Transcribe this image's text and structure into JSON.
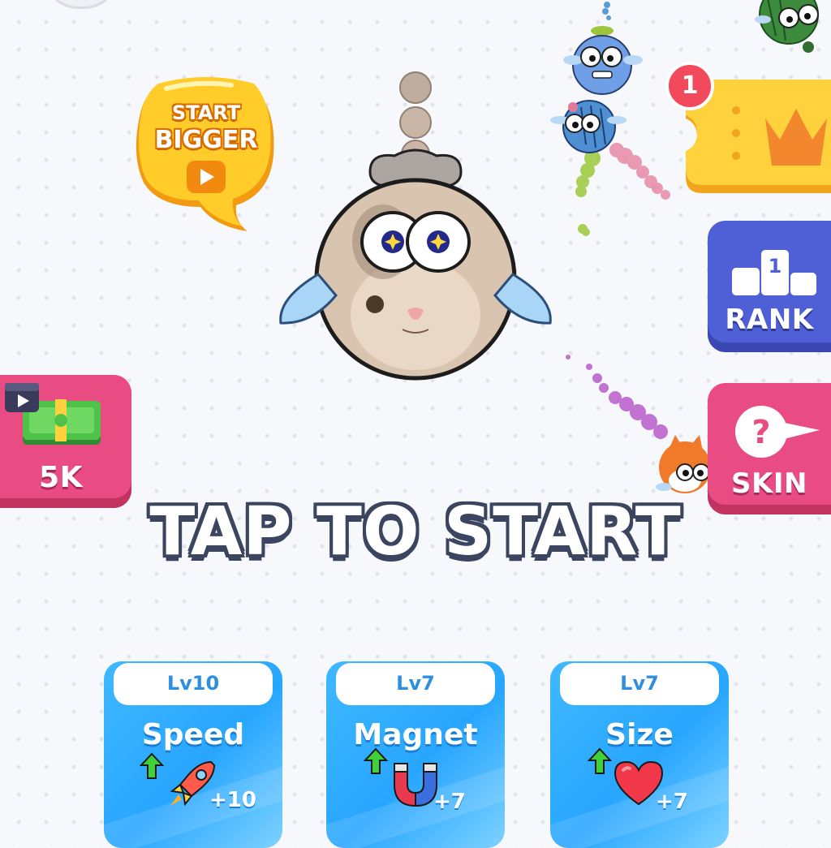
{
  "start_bigger": {
    "line1": "START",
    "line2": "BIGGER"
  },
  "ticket": {
    "badge_count": "1"
  },
  "rank": {
    "label": "RANK",
    "podium_number": "1"
  },
  "skin": {
    "label": "SKIN",
    "icon_glyph": "?"
  },
  "cash": {
    "label": "5K"
  },
  "prompt": "TAP TO START",
  "upgrades": [
    {
      "level": "Lv10",
      "name": "Speed",
      "bonus": "+10",
      "icon": "rocket-icon"
    },
    {
      "level": "Lv7",
      "name": "Magnet",
      "bonus": "+7",
      "icon": "magnet-icon"
    },
    {
      "level": "Lv7",
      "name": "Size",
      "bonus": "+7",
      "icon": "heart-icon"
    }
  ],
  "colors": {
    "accent_pink": "#e94c83",
    "accent_blue": "#4f5fd6",
    "card_blue": "#28a6ff",
    "ticket_yellow": "#ffd23d",
    "badge_red": "#f24a5c"
  }
}
